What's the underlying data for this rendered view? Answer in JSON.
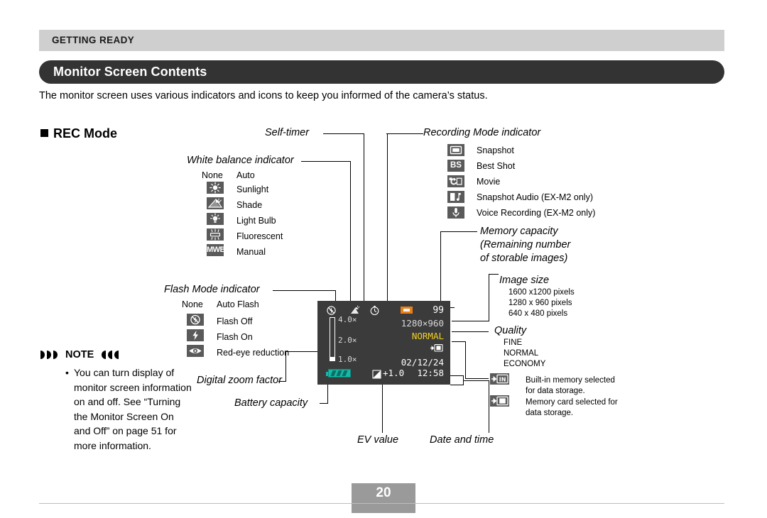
{
  "header": {
    "running_head": "GETTING READY",
    "section_title": "Monitor Screen Contents",
    "intro": "The monitor screen uses various indicators and icons to keep you informed of the camera’s status."
  },
  "rec_mode_heading": "REC Mode",
  "callouts": {
    "self_timer": "Self-timer",
    "white_balance": "White balance indicator",
    "flash_mode": "Flash Mode indicator",
    "recording_mode": "Recording Mode indicator",
    "memory_capacity_l1": "Memory capacity",
    "memory_capacity_l2": "(Remaining number",
    "memory_capacity_l3": "of storable images)",
    "image_size": "Image size",
    "quality": "Quality",
    "digital_zoom": "Digital zoom factor",
    "battery_capacity": "Battery capacity",
    "ev_value": "EV value",
    "date_and_time": "Date and time"
  },
  "white_balance": {
    "items": [
      {
        "icon": "none-text",
        "icon_label": "None",
        "label": "Auto"
      },
      {
        "icon": "sunlight-icon",
        "icon_label": "",
        "label": "Sunlight"
      },
      {
        "icon": "shade-icon",
        "icon_label": "",
        "label": "Shade"
      },
      {
        "icon": "light-bulb-icon",
        "icon_label": "",
        "label": "Light Bulb"
      },
      {
        "icon": "fluorescent-icon",
        "icon_label": "",
        "label": "Fluorescent"
      },
      {
        "icon": "manual-wb-icon",
        "icon_label": "MWB",
        "label": "Manual"
      }
    ]
  },
  "flash_mode": {
    "items": [
      {
        "icon": "none-text",
        "icon_label": "None",
        "label": "Auto Flash"
      },
      {
        "icon": "flash-off-icon",
        "icon_label": "",
        "label": "Flash Off"
      },
      {
        "icon": "flash-on-icon",
        "icon_label": "",
        "label": "Flash On"
      },
      {
        "icon": "red-eye-icon",
        "icon_label": "",
        "label": "Red-eye reduction"
      }
    ]
  },
  "recording_mode": {
    "items": [
      {
        "icon": "snapshot-icon",
        "label": "Snapshot"
      },
      {
        "icon": "best-shot-icon",
        "label": "Best Shot"
      },
      {
        "icon": "movie-icon",
        "label": "Movie"
      },
      {
        "icon": "snapshot-audio-icon",
        "label": "Snapshot Audio (EX-M2 only)"
      },
      {
        "icon": "voice-recording-icon",
        "label": "Voice Recording (EX-M2 only)"
      }
    ]
  },
  "image_size": {
    "options": [
      "1600 x1200 pixels",
      "1280 x  960 pixels",
      "640 x  480 pixels"
    ]
  },
  "quality": {
    "options": [
      "FINE",
      "NORMAL",
      "ECONOMY"
    ]
  },
  "storage": {
    "items": [
      {
        "icon": "built-in-memory-icon",
        "line1": "Built-in memory selected",
        "line2": "for data storage."
      },
      {
        "icon": "memory-card-icon",
        "line1": "Memory card selected for",
        "line2": "data storage."
      }
    ]
  },
  "note": {
    "heading": "NOTE",
    "bullet": "•",
    "text": "You can turn display of monitor screen information on and off. See “Turning the Monitor Screen On and Off” on page 51 for more information."
  },
  "lcd": {
    "capacity": "99",
    "image_size": "1280×960",
    "quality": "NORMAL",
    "storage_icon": "built-in-memory-icon",
    "zoom_top": "4.0×",
    "zoom_mid": "2.0×",
    "zoom_bottom": "1.0×",
    "ev_value": "+1.0",
    "date": "02/12/24",
    "time": "12:58"
  },
  "footer": {
    "page_number": "20"
  },
  "colors": {
    "running_head_bg": "#cfcfcf",
    "section_bar_bg": "#333333",
    "lcd_bg": "#3b3b3b",
    "lcd_quality": "#f2d022",
    "rec_indicator": "#e8801a",
    "battery": "#16b8a8",
    "icon_chip": "#5a5a5a",
    "footer": "#9a9a9a"
  }
}
